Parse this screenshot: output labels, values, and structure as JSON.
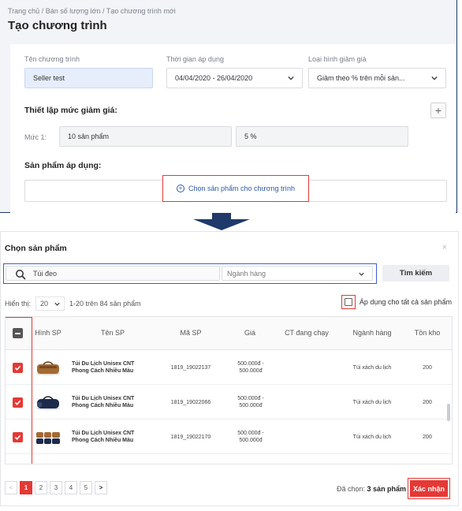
{
  "breadcrumb": "Trang chủ  /  Bán số lượng lớn  /  Tạo chương trình mới",
  "page_title": "Tạo chương trình",
  "form": {
    "name_label": "Tên chương trình",
    "name_value": "Seller test",
    "time_label": "Thời gian áp dụng",
    "time_value": "04/04/2020 - 26/04/2020",
    "discount_type_label": "Loại hình giảm giá",
    "discount_type_value": "Giảm theo % trên mỗi sản...",
    "discount_section_title": "Thiết lập mức giảm giá:",
    "level_label": "Mức 1:",
    "level_quantity": "10 sản phẩm",
    "level_percent": "5 %",
    "products_section_title": "Sản phẩm áp dụng:",
    "pick_products_label": "Chọn sản phẩm cho chương trình",
    "add_level_symbol": "+"
  },
  "modal": {
    "title": "Chọn sản phẩm",
    "close_symbol": "×",
    "search_value": "Túi đeo",
    "category_placeholder": "Ngành hàng",
    "search_button": "Tìm kiếm",
    "show_label": "Hiển thị:",
    "page_size": "20",
    "range_text": "1-20 trên 84 sản phẩm",
    "apply_all_label": "Áp dụng cho tất cả sản phẩm",
    "columns": [
      "Hình SP",
      "Tên SP",
      "Mã SP",
      "Giá",
      "CT đang chạy",
      "Ngành hàng",
      "Tồn kho"
    ],
    "rows": [
      {
        "name": "Túi Du Lịch Unisex CNT Phong Cách Nhiều Màu",
        "code": "1819_19022137",
        "price": "500.000đ - 500.000đ",
        "running": "",
        "category": "Túi xách du lịch",
        "stock": "200"
      },
      {
        "name": "Túi Du Lịch Unisex CNT Phong Cách Nhiều Màu",
        "code": "1819_19022066",
        "price": "500.000đ - 500.000đ",
        "running": "",
        "category": "Túi xách du lịch",
        "stock": "200"
      },
      {
        "name": "Túi Du Lịch Unisex CNT Phong Cách Nhiều Màu",
        "code": "1819_19022170",
        "price": "500.000đ - 500.000đ",
        "running": "",
        "category": "Túi xách du lịch",
        "stock": "200"
      }
    ],
    "pagination": {
      "prev": "<",
      "pages": [
        "1",
        "2",
        "3",
        "4",
        "5"
      ],
      "next": ">",
      "current": "1"
    },
    "selected_prefix": "Đã chọn:",
    "selected_count": "3 sản phẩm",
    "confirm_label": "Xác nhận"
  },
  "colors": {
    "accent_red": "#e53935",
    "highlight_blue": "#3b5bdb",
    "arrow_navy": "#1f3a6b",
    "link_blue": "#2e5aac"
  }
}
